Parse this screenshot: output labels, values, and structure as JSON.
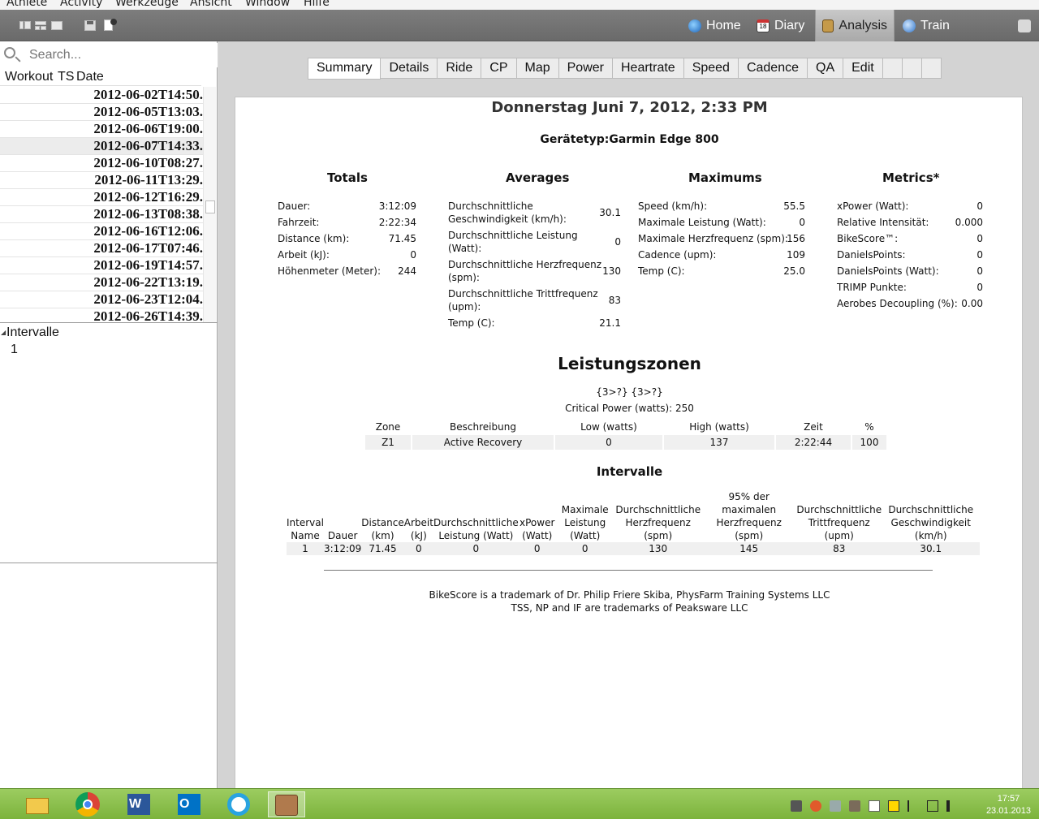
{
  "menubar": {
    "items": [
      "Athlete",
      "Activity",
      "Werkzeuge",
      "Ansicht",
      "Window",
      "Hilfe"
    ]
  },
  "toolbar": {
    "nav": [
      {
        "label": "Home",
        "icon": "home-globe-icon"
      },
      {
        "label": "Diary",
        "icon": "calendar-icon",
        "badge": "18"
      },
      {
        "label": "Analysis",
        "icon": "abacus-icon",
        "active": true
      },
      {
        "label": "Train",
        "icon": "train-magnifier-icon"
      }
    ]
  },
  "sidebar": {
    "search_placeholder": "Search...",
    "columns": [
      "Workout",
      "TS",
      "Date"
    ],
    "rides": [
      "2012-06-02T14:50.",
      "2012-06-05T13:03.",
      "2012-06-06T19:00.",
      "2012-06-07T14:33.",
      "2012-06-10T08:27.",
      "2012-06-11T13:29.",
      "2012-06-12T16:29.",
      "2012-06-13T08:38.",
      "2012-06-16T12:06.",
      "2012-06-17T07:46.",
      "2012-06-19T14:57.",
      "2012-06-22T13:19.",
      "2012-06-23T12:04.",
      "2012-06-26T14:39."
    ],
    "selected_ride_index": 3,
    "intervals_label": "Intervalle",
    "intervals": [
      "1"
    ]
  },
  "tabs": [
    "Summary",
    "Details",
    "Ride",
    "CP",
    "Map",
    "Power",
    "Heartrate",
    "Speed",
    "Cadence",
    "QA",
    "Edit",
    "",
    "",
    ""
  ],
  "active_tab": "Summary",
  "report": {
    "title": "Donnerstag Juni 7, 2012, 2:33 PM",
    "device": "Gerätetyp:Garmin Edge 800",
    "totals": {
      "heading": "Totals",
      "rows": [
        {
          "k": "Dauer:",
          "v": "3:12:09"
        },
        {
          "k": "Fahrzeit:",
          "v": "2:22:34"
        },
        {
          "k": "Distance (km):",
          "v": "71.45"
        },
        {
          "k": "Arbeit (kJ):",
          "v": "0"
        },
        {
          "k": "Höhenmeter (Meter):",
          "v": "244"
        }
      ]
    },
    "averages": {
      "heading": "Averages",
      "rows": [
        {
          "k1": "Durchschnittliche",
          "k2": "Geschwindigkeit (km/h):",
          "v": "30.1"
        },
        {
          "k1": "Durchschnittliche Leistung",
          "k2": "(Watt):",
          "v": "0"
        },
        {
          "k1": "Durchschnittliche Herzfrequenz",
          "k2": "(spm):",
          "v": "130"
        },
        {
          "k1": "Durchschnittliche Trittfrequenz",
          "k2": "(upm):",
          "v": "83"
        },
        {
          "k1": "Temp (C):",
          "k2": "",
          "v": "21.1"
        }
      ]
    },
    "maximums": {
      "heading": "Maximums",
      "rows": [
        {
          "k": "Speed (km/h):",
          "v": "55.5"
        },
        {
          "k": "Maximale Leistung (Watt):",
          "v": "0"
        },
        {
          "k": "Maximale Herzfrequenz (spm):",
          "v": "156"
        },
        {
          "k": "Cadence (upm):",
          "v": "109"
        },
        {
          "k": "Temp (C):",
          "v": "25.0"
        }
      ]
    },
    "metrics": {
      "heading": "Metrics*",
      "rows": [
        {
          "k": "xPower (Watt):",
          "v": "0"
        },
        {
          "k": "Relative Intensität:",
          "v": "0.000"
        },
        {
          "k": "BikeScore™:",
          "v": "0"
        },
        {
          "k": "DanielsPoints:",
          "v": "0"
        },
        {
          "k": "DanielsPoints (Watt):",
          "v": "0"
        },
        {
          "k": "TRIMP Punkte:",
          "v": "0"
        },
        {
          "k": "Aerobes Decoupling (%):",
          "v": "0.00"
        }
      ]
    },
    "zones": {
      "heading": "Leistungszonen",
      "template_text": "{3>?} {3>?}",
      "cp_text": "Critical Power (watts): 250",
      "columns": [
        "Zone",
        "Beschreibung",
        "Low (watts)",
        "High (watts)",
        "Zeit",
        "%"
      ],
      "rows": [
        [
          "Z1",
          "Active Recovery",
          "0",
          "137",
          "2:22:44",
          "100"
        ]
      ]
    },
    "intervals": {
      "heading": "Intervalle",
      "columns": [
        [
          "Interval",
          "Name"
        ],
        [
          "Dauer"
        ],
        [
          "Distance",
          "(km)"
        ],
        [
          "Arbeit",
          "(kJ)"
        ],
        [
          "Durchschnittliche",
          "Leistung (Watt)"
        ],
        [
          "xPower",
          "(Watt)"
        ],
        [
          "Maximale",
          "Leistung",
          "(Watt)"
        ],
        [
          "Durchschnittliche",
          "Herzfrequenz",
          "(spm)"
        ],
        [
          "95% der",
          "maximalen",
          "Herzfrequenz (spm)"
        ],
        [
          "Durchschnittliche",
          "Trittfrequenz",
          "(upm)"
        ],
        [
          "Durchschnittliche",
          "Geschwindigkeit",
          "(km/h)"
        ]
      ],
      "rows": [
        [
          "1",
          "3:12:09",
          "71.45",
          "0",
          "0",
          "0",
          "0",
          "130",
          "145",
          "83",
          "30.1"
        ]
      ]
    },
    "footer": [
      "BikeScore is a trademark of Dr. Philip Friere Skiba, PhysFarm Training Systems LLC",
      "TSS, NP and IF are trademarks of Peaksware LLC"
    ]
  },
  "taskbar": {
    "apps": [
      "file-explorer-icon",
      "chrome-icon",
      "word-icon",
      "outlook-icon",
      "internet-explorer-icon",
      "golden-cheetah-icon"
    ],
    "clock_time": "17:57",
    "clock_date": "23.01.2013"
  }
}
